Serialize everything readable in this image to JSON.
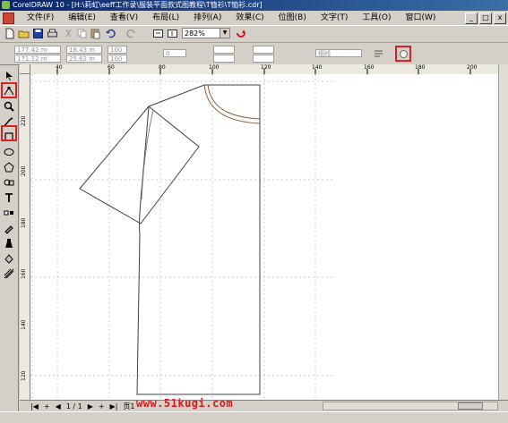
{
  "window": {
    "title": "CorelDRAW 10 - [H:\\莉虹\\eeff工作录\\服装平面款式图教程\\T恤衫\\T恤衫.cdr]",
    "controls": [
      "_",
      "□",
      "x"
    ]
  },
  "menubar": {
    "items": [
      "文件(F)",
      "编辑(E)",
      "查看(V)",
      "布局(L)",
      "排列(A)",
      "效果(C)",
      "位图(B)",
      "文字(T)",
      "工具(O)",
      "窗口(W)"
    ]
  },
  "toolbar": {
    "zoom_value": "282%"
  },
  "property_bar": {
    "x_value": "177.42 m",
    "y_value": "171.12 m",
    "width_value": "18.43 m",
    "height_value": "25.62 m",
    "scale_x": "100",
    "scale_y": "100",
    "rotation": "0",
    "outline_label": "细线"
  },
  "rulers": {
    "horizontal_labels": [
      "40",
      "60",
      "80",
      "100",
      "120",
      "140",
      "160",
      "180",
      "200"
    ],
    "vertical_labels": [
      "220",
      "200",
      "180",
      "160",
      "140",
      "120"
    ]
  },
  "page_navigator": {
    "page_indicator": "1 / 1",
    "page_tab": "页1"
  },
  "watermark": {
    "text": "www.51kugi.com",
    "color": "#e01818"
  },
  "colors": {
    "highlight": "#e02020",
    "garment_outline": "#404040",
    "neck_trim": "#8a5a30"
  }
}
